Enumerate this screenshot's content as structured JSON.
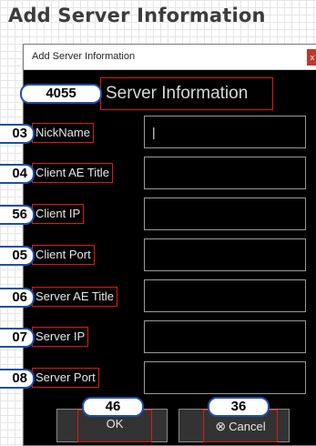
{
  "heading": "Add Server Information",
  "window": {
    "title": "Add Server Information",
    "close_glyph": "x"
  },
  "section_title": "Server Information",
  "fields": [
    {
      "label": "NickName",
      "value": "|",
      "callout": "03"
    },
    {
      "label": "Client AE Title",
      "value": "",
      "callout": "04"
    },
    {
      "label": "Client IP",
      "value": "",
      "callout": "56"
    },
    {
      "label": "Client Port",
      "value": "",
      "callout": "05"
    },
    {
      "label": "Server AE Title",
      "value": "",
      "callout": "06"
    },
    {
      "label": "Server IP",
      "value": "",
      "callout": "07"
    },
    {
      "label": "Server Port",
      "value": "",
      "callout": "08"
    }
  ],
  "buttons": {
    "ok": {
      "label": "OK",
      "callout": "46"
    },
    "cancel": {
      "label": "Cancel",
      "icon": "cancel-circle-icon",
      "glyph": "⊗",
      "callout": "36"
    }
  },
  "section_callout": "4055",
  "colors": {
    "annotation_red": "#e01818",
    "callout_blue": "#1f4fa8",
    "window_bg": "#000000"
  }
}
